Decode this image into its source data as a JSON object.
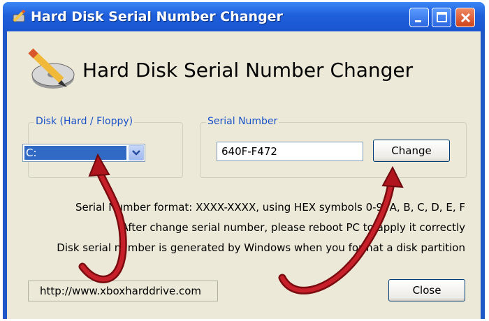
{
  "window": {
    "title": "Hard Disk Serial Number Changer",
    "icon": "pencil-disk-icon"
  },
  "controls": {
    "minimize": "minimize-icon",
    "maximize": "maximize-icon",
    "close": "close-icon"
  },
  "header": {
    "title": "Hard Disk Serial Number Changer",
    "logo": "pencil-disk-logo"
  },
  "disk_group": {
    "legend": "Disk (Hard / Floppy)",
    "selected": "C:"
  },
  "serial_group": {
    "legend": "Serial Number",
    "value": "640F-F472",
    "change_label": "Change"
  },
  "info_lines": [
    "Serial Number format: XXXX-XXXX, using HEX symbols 0-9, A, B, C, D, E, F",
    "After change serial number, please reboot PC to apply it correctly",
    "Disk serial number is generated by Windows when you format a disk partition"
  ],
  "footer": {
    "url": "http://www.xboxharddrive.com",
    "close_label": "Close"
  },
  "colors": {
    "titlebar": "#1f5fdb",
    "dialog_bg": "#ece9d8",
    "selection": "#316ac5",
    "legend_text": "#1a52c8",
    "annotation_arrow": "#b0141c"
  }
}
